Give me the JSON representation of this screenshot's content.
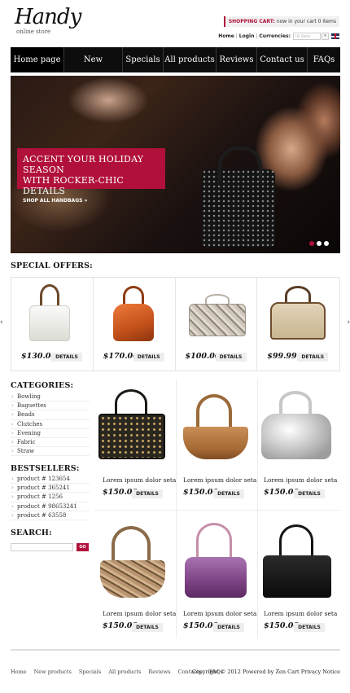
{
  "header": {
    "logo_title": "Handy",
    "logo_subtitle": "online store",
    "cart_label": "SHOPPING CART:",
    "cart_text": "now in your cart 0 items",
    "top_links": [
      "Home",
      "Login"
    ],
    "currencies_label": "Currencies:",
    "currency_selected": "US Dollar"
  },
  "nav": {
    "items": [
      "Home page",
      "New products",
      "Specials",
      "All products",
      "Reviews",
      "Contact us",
      "FAQs"
    ],
    "active_index": 0
  },
  "hero": {
    "headline_line1": "ACCENT YOUR HOLIDAY SEASON",
    "headline_line2": "WITH ROCKER-CHIC DETAILS",
    "cta": "SHOP ALL HANDBAGS »",
    "slide_count": 3,
    "active_slide": 0
  },
  "special_offers": {
    "title": "SPECIAL OFFERS:",
    "details_label": "DETAILS",
    "items": [
      {
        "price": "$130.00",
        "icon": "white-tote-bag-icon"
      },
      {
        "price": "$170.00",
        "icon": "orange-leather-bag-icon"
      },
      {
        "price": "$100.00",
        "icon": "python-clutch-icon"
      },
      {
        "price": "$99.99",
        "icon": "beige-satchel-icon"
      }
    ]
  },
  "categories": {
    "title": "CATEGORIES:",
    "items": [
      "Bowling",
      "Baguettes",
      "Beads",
      "Clutches",
      "Evening",
      "Fabric",
      "Straw"
    ]
  },
  "bestsellers": {
    "title": "BESTSELLERS:",
    "items": [
      "product # 123654",
      "product # 365241",
      "product # 1256",
      "product # 98653241",
      "product # 63558"
    ]
  },
  "search": {
    "title": "SEARCH:",
    "button": "GO"
  },
  "products": {
    "details_label": "DETAILS",
    "items": [
      {
        "name": "Lorem ipsum dolor seta",
        "price": "$150.00",
        "icon": "studded-black-bag-icon"
      },
      {
        "name": "Lorem ipsum dolor seta",
        "price": "$150.00",
        "icon": "brown-hobo-bag-icon"
      },
      {
        "name": "Lorem ipsum dolor seta",
        "price": "$150.00",
        "icon": "silver-knot-bag-icon"
      },
      {
        "name": "Lorem ipsum dolor seta",
        "price": "$150.00",
        "icon": "snakeskin-hobo-icon"
      },
      {
        "name": "Lorem ipsum dolor seta",
        "price": "$150.00",
        "icon": "purple-charm-bag-icon"
      },
      {
        "name": "Lorem ipsum dolor seta",
        "price": "$150.00",
        "icon": "black-leather-tote-icon"
      }
    ]
  },
  "footer": {
    "links": [
      "Home",
      "New products",
      "Specials",
      "All products",
      "Reviews",
      "Contacts",
      "FAQs"
    ],
    "copyright": "Copyright © 2012 Powered by Zen Cart Privacy Notice"
  },
  "colors": {
    "accent": "#b0103a",
    "nav_background": "#0d0d0d"
  }
}
